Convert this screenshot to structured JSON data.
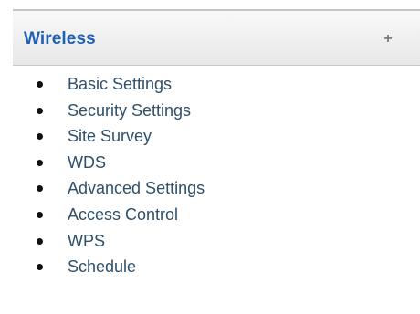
{
  "section": {
    "title": "Wireless",
    "expand_symbol": "+",
    "expand_icon_name": "plus-icon",
    "title_color": "#1f5fb4"
  },
  "menu": {
    "items": [
      {
        "label": "Basic Settings"
      },
      {
        "label": "Security Settings"
      },
      {
        "label": "Site Survey"
      },
      {
        "label": "WDS"
      },
      {
        "label": "Advanced Settings"
      },
      {
        "label": "Access Control"
      },
      {
        "label": "WPS"
      },
      {
        "label": "Schedule"
      }
    ]
  }
}
